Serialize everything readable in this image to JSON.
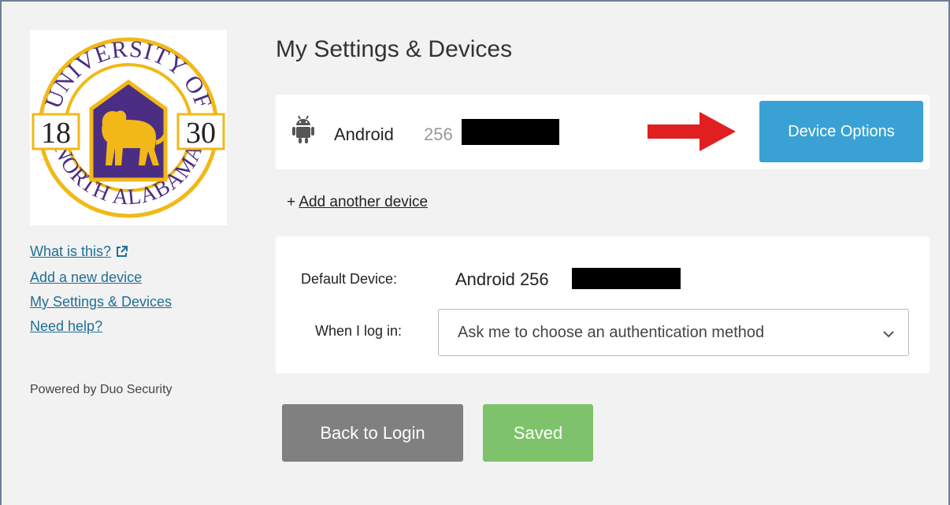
{
  "sidebar": {
    "logo": {
      "name": "university-seal",
      "text_top": "UNIVERSITY OF",
      "text_bottom": "NORTH ALABAMA",
      "year_left": "18",
      "year_right": "30",
      "colors": {
        "purple": "#4b2e83",
        "gold": "#f2b817"
      }
    },
    "links": [
      {
        "label": "What is this?",
        "icon": "external-link-icon"
      },
      {
        "label": "Add a new device"
      },
      {
        "label": "My Settings & Devices"
      },
      {
        "label": "Need help?"
      }
    ],
    "powered_by": "Powered by Duo Security"
  },
  "main": {
    "title": "My Settings & Devices",
    "device": {
      "icon": "android-icon",
      "name": "Android",
      "number_prefix": "256",
      "options_button": "Device Options",
      "annotation": "red-arrow-icon"
    },
    "add_device": {
      "prefix": "+",
      "label": "Add another device"
    },
    "settings": {
      "default_device_label": "Default Device:",
      "default_device_value": "Android 256",
      "when_login_label": "When I log in:",
      "when_login_selected": "Ask me to choose an authentication method"
    },
    "buttons": {
      "back": "Back to Login",
      "saved": "Saved"
    }
  },
  "colors": {
    "background": "#f2f2f2",
    "link": "#1f6f96",
    "device_options": "#3aa1d4",
    "back_button": "#808080",
    "saved_button": "#7ec36b",
    "arrow": "#e02020"
  }
}
